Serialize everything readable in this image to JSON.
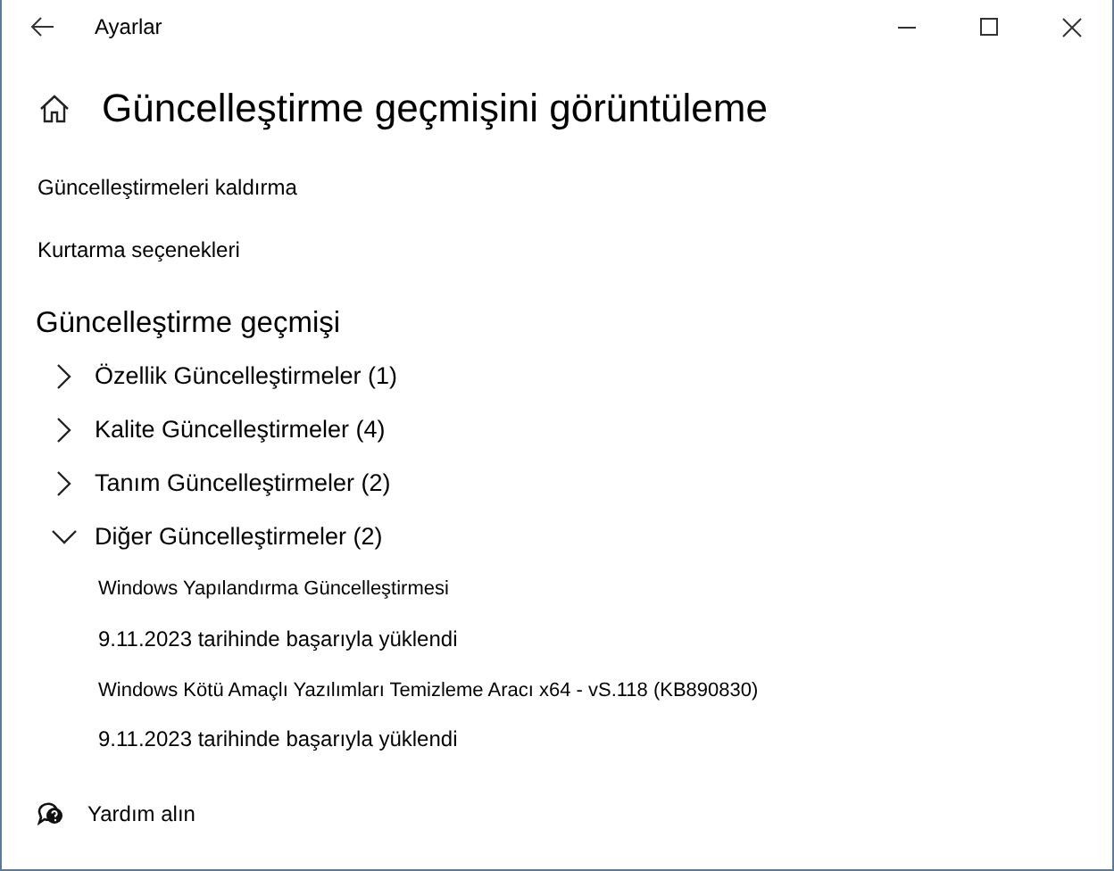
{
  "window": {
    "title": "Ayarlar"
  },
  "page_title": "Güncelleştirme geçmişini görüntüleme",
  "links": [
    "Güncelleştirmeleri kaldırma",
    "Kurtarma seçenekleri"
  ],
  "history": {
    "heading": "Güncelleştirme geçmişi",
    "groups": [
      {
        "label": "Özellik Güncelleştirmeler (1)",
        "expanded": false
      },
      {
        "label": "Kalite Güncelleştirmeler (4)",
        "expanded": false
      },
      {
        "label": "Tanım Güncelleştirmeler (2)",
        "expanded": false
      },
      {
        "label": "Diğer Güncelleştirmeler (2)",
        "expanded": true,
        "items": [
          {
            "name": "Windows Yapılandırma Güncelleştirmesi",
            "status": "9.11.2023 tarihinde başarıyla yüklendi"
          },
          {
            "name": "Windows Kötü Amaçlı Yazılımları Temizleme Aracı x64 - vS.118 (KB890830)",
            "status": "9.11.2023 tarihinde başarıyla yüklendi"
          }
        ]
      }
    ]
  },
  "help": "Yardım alın"
}
